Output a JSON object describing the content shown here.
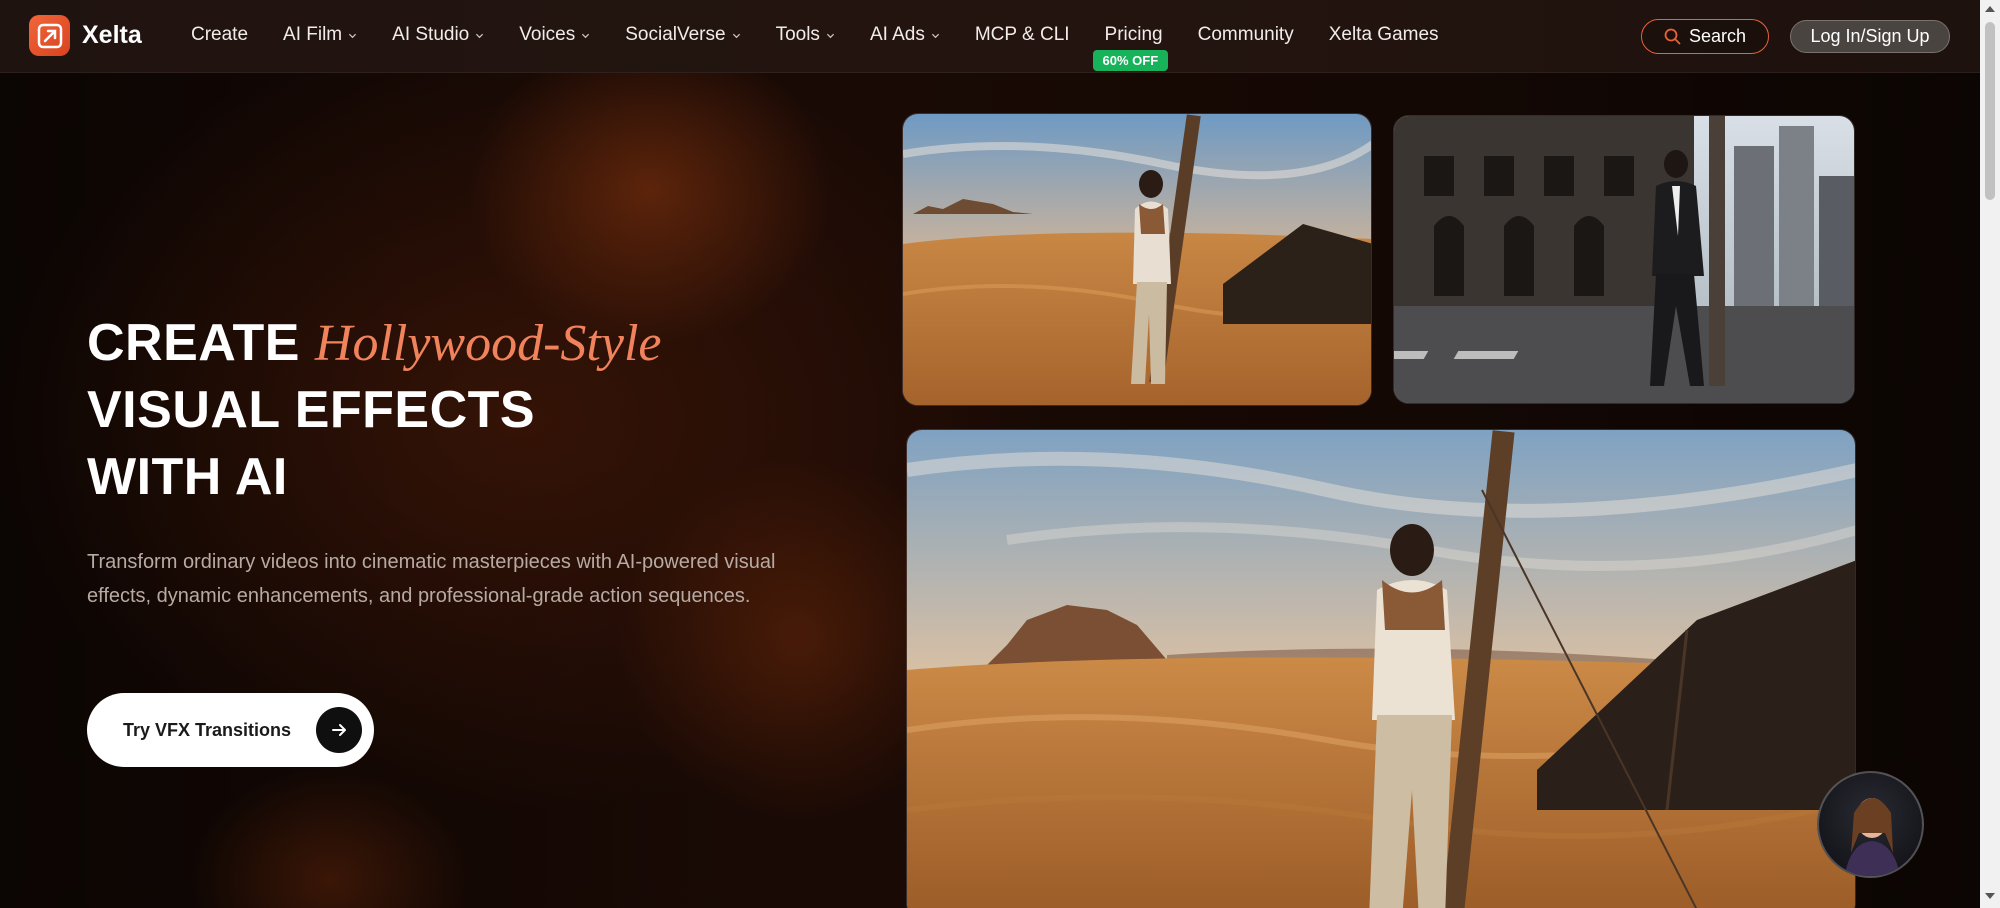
{
  "brand": {
    "name": "Xelta"
  },
  "nav": {
    "items": [
      {
        "label": "Create",
        "dropdown": false
      },
      {
        "label": "AI Film",
        "dropdown": true
      },
      {
        "label": "AI Studio",
        "dropdown": true
      },
      {
        "label": "Voices",
        "dropdown": true
      },
      {
        "label": "SocialVerse",
        "dropdown": true
      },
      {
        "label": "Tools",
        "dropdown": true
      },
      {
        "label": "AI Ads",
        "dropdown": true
      },
      {
        "label": "MCP & CLI",
        "dropdown": false
      },
      {
        "label": "Pricing",
        "dropdown": false,
        "badge": "60% OFF"
      },
      {
        "label": "Community",
        "dropdown": false
      },
      {
        "label": "Xelta Games",
        "dropdown": false
      }
    ],
    "search_label": "Search",
    "login_label": "Log In/Sign Up"
  },
  "hero": {
    "line1_prefix": "CREATE",
    "line1_accent": "Hollywood-Style",
    "line2": "VISUAL EFFECTS",
    "line3": "WITH AI",
    "description": "Transform ordinary videos into cinematic masterpieces with AI-powered visual effects, dynamic enhancements, and professional-grade action sequences.",
    "cta_label": "Try VFX Transitions"
  },
  "colors": {
    "accent": "#f0835b",
    "brand": "#e8552f",
    "badge": "#17b25a"
  },
  "icons": {
    "search": "search-icon",
    "arrow": "arrow-right-icon",
    "chevron": "chevron-down-icon"
  }
}
